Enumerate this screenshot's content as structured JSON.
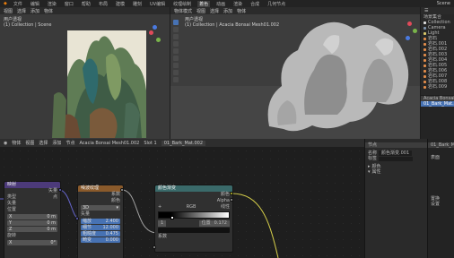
{
  "topbar": {
    "menus": [
      "文件",
      "编辑",
      "渲染",
      "窗口",
      "帮助"
    ],
    "tabs": [
      "布局",
      "建模",
      "雕刻",
      "UV编辑",
      "纹理绘制",
      "着色",
      "动画",
      "渲染",
      "合成",
      "几何节点"
    ],
    "active_tab": "着色",
    "scene": "Scene"
  },
  "viewport_left": {
    "header_items": [
      "视图",
      "选择",
      "添加",
      "物体"
    ],
    "label_line1": "用户透视",
    "label_line2": "(1) Collection | Scene"
  },
  "viewport_right": {
    "header_items": [
      "物体模式",
      "视图",
      "选择",
      "添加",
      "物体"
    ],
    "label_line1": "用户透视",
    "label_line2": "(1) Collection | Acacia Bonsai Mesh01.002"
  },
  "outliner": {
    "title": "场景集合",
    "items": [
      "Collection",
      "Camera",
      "Light",
      "岩石",
      "岩石.001",
      "岩石.002",
      "岩石.003",
      "岩石.004",
      "岩石.005",
      "岩石.006",
      "岩石.007",
      "岩石.008",
      "岩石.009"
    ]
  },
  "properties": {
    "object_name": "Acacia Bonsai",
    "material": "01_Bark_Mat.002"
  },
  "node_editor": {
    "header_items": [
      "物体",
      "视图",
      "选择",
      "添加",
      "节点"
    ],
    "object_name": "Acacia Bonsai Mesh01.002",
    "slot": "Slot 1",
    "material": "01_Bark_Mat.002"
  },
  "nodes": {
    "texcoord": {
      "title": "映射",
      "outputs": [
        "矢量"
      ],
      "type_label": "类型",
      "type_value": "点",
      "vector_label": "矢量",
      "location_label": "位置",
      "x_value": "0 m",
      "y_value": "0 m",
      "z_value": "0 m",
      "rotation_label": "旋转",
      "rx": "0°",
      "ry": "0°"
    },
    "noise": {
      "title": "噪波纹理",
      "outputs": [
        "系数",
        "颜色"
      ],
      "dim_value": "3D",
      "vector_label": "矢量",
      "scale_label": "缩放",
      "scale_value": "2.400",
      "detail_label": "细节",
      "detail_value": "12.000",
      "rough_label": "粗糙度",
      "rough_value": "0.475",
      "distortion_label": "畸变",
      "distortion_value": "0.000"
    },
    "ramp": {
      "title": "颜色渐变",
      "outputs": [
        "颜色",
        "Alpha"
      ],
      "mode": "RGB",
      "interp": "线性",
      "stop_index": "1",
      "pos_label": "位置",
      "pos_value": "0.172",
      "input_label": "系数"
    }
  },
  "side_panel": {
    "tab": "节点",
    "name_label": "名称",
    "name_value": "颜色渐变.001",
    "label_label": "标签",
    "color_label": "颜色",
    "props_label": "属性"
  },
  "right_col": {
    "items": [
      "01_Bark_Mat",
      "表面",
      "置换",
      "设置"
    ]
  },
  "colors": {
    "accent": "#4772b3",
    "noise_header": "#8a5a2b",
    "mapping_header": "#4c3a7a",
    "ramp_header": "#3a6a6a",
    "link_yellow": "#d6cf4a"
  }
}
